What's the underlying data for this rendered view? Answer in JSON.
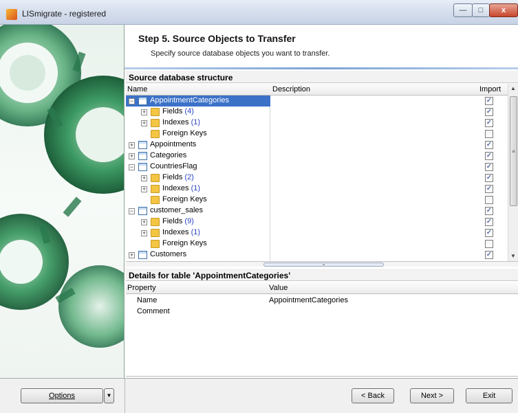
{
  "window": {
    "title": "LISmigrate - registered",
    "controls": {
      "minimize": "—",
      "maximize": "□",
      "close": "x"
    }
  },
  "header": {
    "title": "Step 5. Source Objects to Transfer",
    "subtitle": "Specify source database objects you want to transfer."
  },
  "structure": {
    "heading": "Source database structure",
    "columns": {
      "name": "Name",
      "description": "Description",
      "import": "Import"
    },
    "rows": [
      {
        "indent": 0,
        "expander": "−",
        "icon": "table",
        "name": "AppointmentCategories",
        "count": "",
        "checked": true,
        "selected": true
      },
      {
        "indent": 1,
        "expander": "+",
        "icon": "folder",
        "name": "Fields ",
        "count": "(4)",
        "checked": true,
        "selected": false
      },
      {
        "indent": 1,
        "expander": "+",
        "icon": "folder",
        "name": "Indexes ",
        "count": "(1)",
        "checked": true,
        "selected": false
      },
      {
        "indent": 1,
        "expander": "",
        "icon": "folder",
        "name": "Foreign Keys",
        "count": "",
        "checked": false,
        "selected": false
      },
      {
        "indent": 0,
        "expander": "+",
        "icon": "table",
        "name": "Appointments",
        "count": "",
        "checked": true,
        "selected": false
      },
      {
        "indent": 0,
        "expander": "+",
        "icon": "table",
        "name": "Categories",
        "count": "",
        "checked": true,
        "selected": false
      },
      {
        "indent": 0,
        "expander": "−",
        "icon": "table",
        "name": "CountriesFlag",
        "count": "",
        "checked": true,
        "selected": false
      },
      {
        "indent": 1,
        "expander": "+",
        "icon": "folder",
        "name": "Fields ",
        "count": "(2)",
        "checked": true,
        "selected": false
      },
      {
        "indent": 1,
        "expander": "+",
        "icon": "folder",
        "name": "Indexes ",
        "count": "(1)",
        "checked": true,
        "selected": false
      },
      {
        "indent": 1,
        "expander": "",
        "icon": "folder",
        "name": "Foreign Keys",
        "count": "",
        "checked": false,
        "selected": false
      },
      {
        "indent": 0,
        "expander": "−",
        "icon": "table",
        "name": "customer_sales",
        "count": "",
        "checked": true,
        "selected": false
      },
      {
        "indent": 1,
        "expander": "+",
        "icon": "folder",
        "name": "Fields ",
        "count": "(9)",
        "checked": true,
        "selected": false
      },
      {
        "indent": 1,
        "expander": "+",
        "icon": "folder",
        "name": "Indexes ",
        "count": "(1)",
        "checked": true,
        "selected": false
      },
      {
        "indent": 1,
        "expander": "",
        "icon": "folder",
        "name": "Foreign Keys",
        "count": "",
        "checked": false,
        "selected": false
      },
      {
        "indent": 0,
        "expander": "+",
        "icon": "table",
        "name": "Customers",
        "count": "",
        "checked": true,
        "selected": false
      }
    ]
  },
  "details": {
    "heading": "Details for table 'AppointmentCategories'",
    "columns": {
      "property": "Property",
      "value": "Value"
    },
    "rows": [
      {
        "property": "Name",
        "value": "AppointmentCategories"
      },
      {
        "property": "Comment",
        "value": ""
      }
    ]
  },
  "footer": {
    "options_label": "Options",
    "back_label": "< Back",
    "next_label": "Next >",
    "exit_label": "Exit"
  }
}
